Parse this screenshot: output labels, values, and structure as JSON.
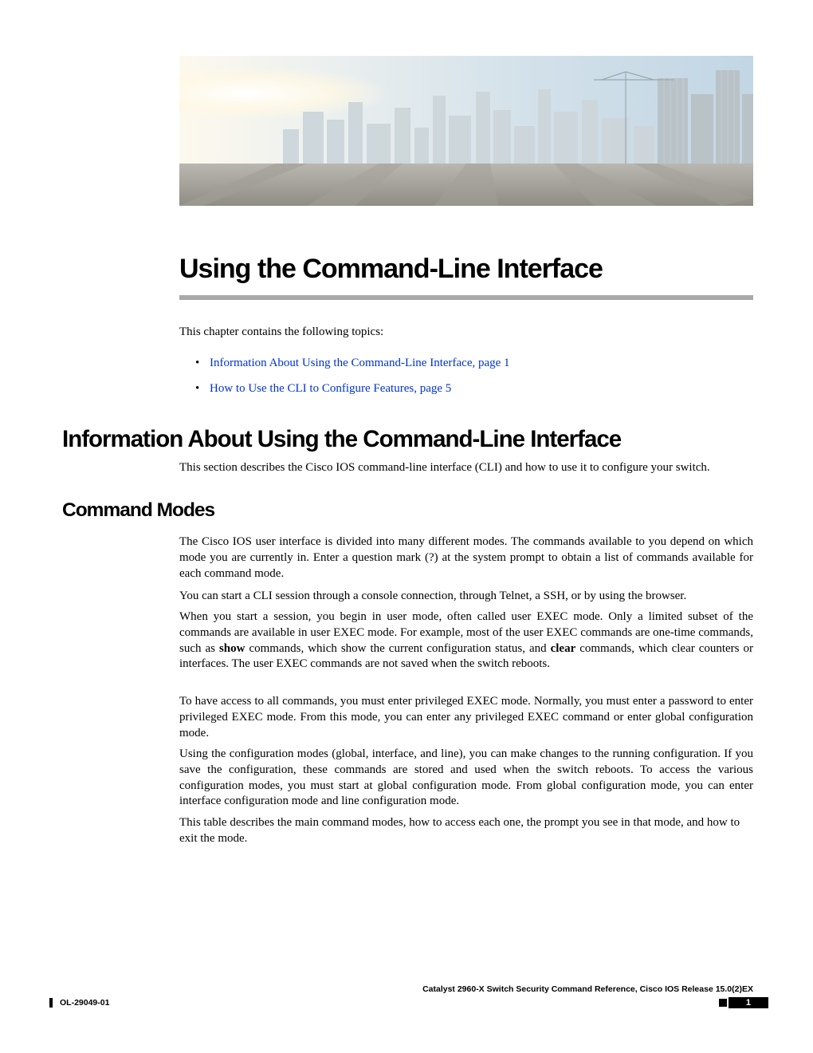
{
  "chapter": {
    "title": "Using the Command-Line Interface",
    "intro": "This chapter contains the following topics:",
    "toc": [
      {
        "text": "Information About Using the Command-Line Interface,  page  1"
      },
      {
        "text": "How to Use the CLI to Configure Features,  page  5"
      }
    ]
  },
  "section1": {
    "heading": "Information About Using the Command-Line Interface",
    "desc": "This section describes the Cisco IOS command-line interface (CLI) and how to use it to configure your switch."
  },
  "section2": {
    "heading": "Command Modes",
    "p1": "The Cisco IOS user interface is divided into many different modes. The commands available to you depend on which mode you are currently in. Enter a question mark (?) at the system prompt to obtain a list of commands available for each command mode.",
    "p2": "You can start a CLI session through a console connection, through Telnet, a SSH, or by using the browser.",
    "p3a": "When you start a session, you begin in user mode, often called user EXEC mode. Only a limited subset of the commands are available in user EXEC mode. For example, most of the user EXEC commands are one-time commands, such as ",
    "p3b_show": "show",
    "p3c": " commands, which show the current configuration status, and ",
    "p3d_clear": "clear",
    "p3e": " commands, which clear counters or interfaces. The user EXEC commands are not saved when the switch reboots.",
    "p4": "To have access to all commands, you must enter privileged EXEC mode. Normally, you must enter a password to enter privileged EXEC mode. From this mode, you can enter any privileged EXEC command or enter global configuration mode.",
    "p5": "Using the configuration modes (global, interface, and line), you can make changes to the running configuration. If you save the configuration, these commands are stored and used when the switch reboots. To access the various configuration modes, you must start at global configuration mode. From global configuration mode, you can enter interface configuration mode and line configuration mode.",
    "p6": "This table describes the main command modes, how to access each one, the prompt you see in that mode, and how to exit the mode."
  },
  "footer": {
    "book_title": "Catalyst 2960-X Switch Security Command Reference, Cisco IOS Release 15.0(2)EX",
    "doc_id": "OL-29049-01",
    "page_num": "1"
  }
}
